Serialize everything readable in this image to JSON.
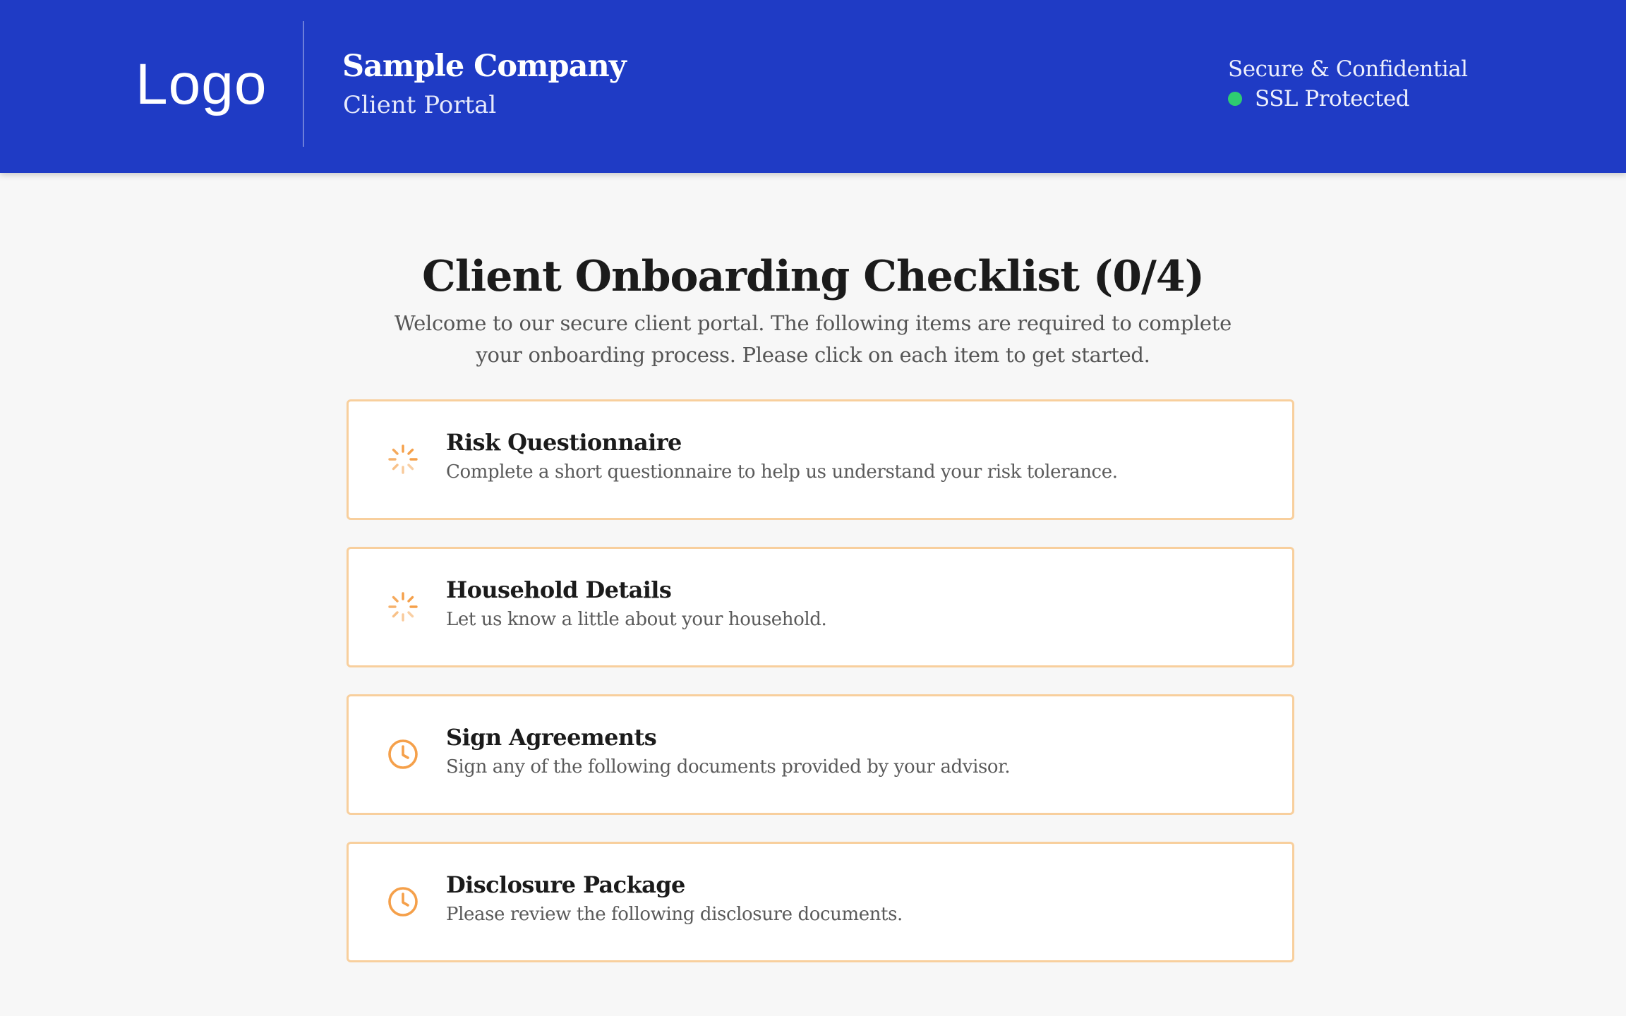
{
  "header": {
    "logo_text": "Logo",
    "company_name": "Sample Company",
    "portal_name": "Client Portal",
    "secure_text": "Secure & Confidential",
    "ssl_text": "SSL Protected",
    "ssl_status_color": "#2ecc71",
    "background_color": "#1f3bc5"
  },
  "main": {
    "title": "Client Onboarding Checklist (0/4)",
    "intro": "Welcome to our secure client portal. The following items are required to complete your onboarding process. Please click on each item to get started.",
    "accent_color": "#f5a04a",
    "items": [
      {
        "title": "Risk Questionnaire",
        "description": "Complete a short questionnaire to help us understand your risk tolerance.",
        "status_icon": "spinner-icon"
      },
      {
        "title": "Household Details",
        "description": "Let us know a little about your household.",
        "status_icon": "spinner-icon"
      },
      {
        "title": "Sign Agreements",
        "description": "Sign any of the following documents provided by your advisor.",
        "status_icon": "clock-icon"
      },
      {
        "title": "Disclosure Package",
        "description": "Please review the following disclosure documents.",
        "status_icon": "clock-icon"
      }
    ]
  }
}
